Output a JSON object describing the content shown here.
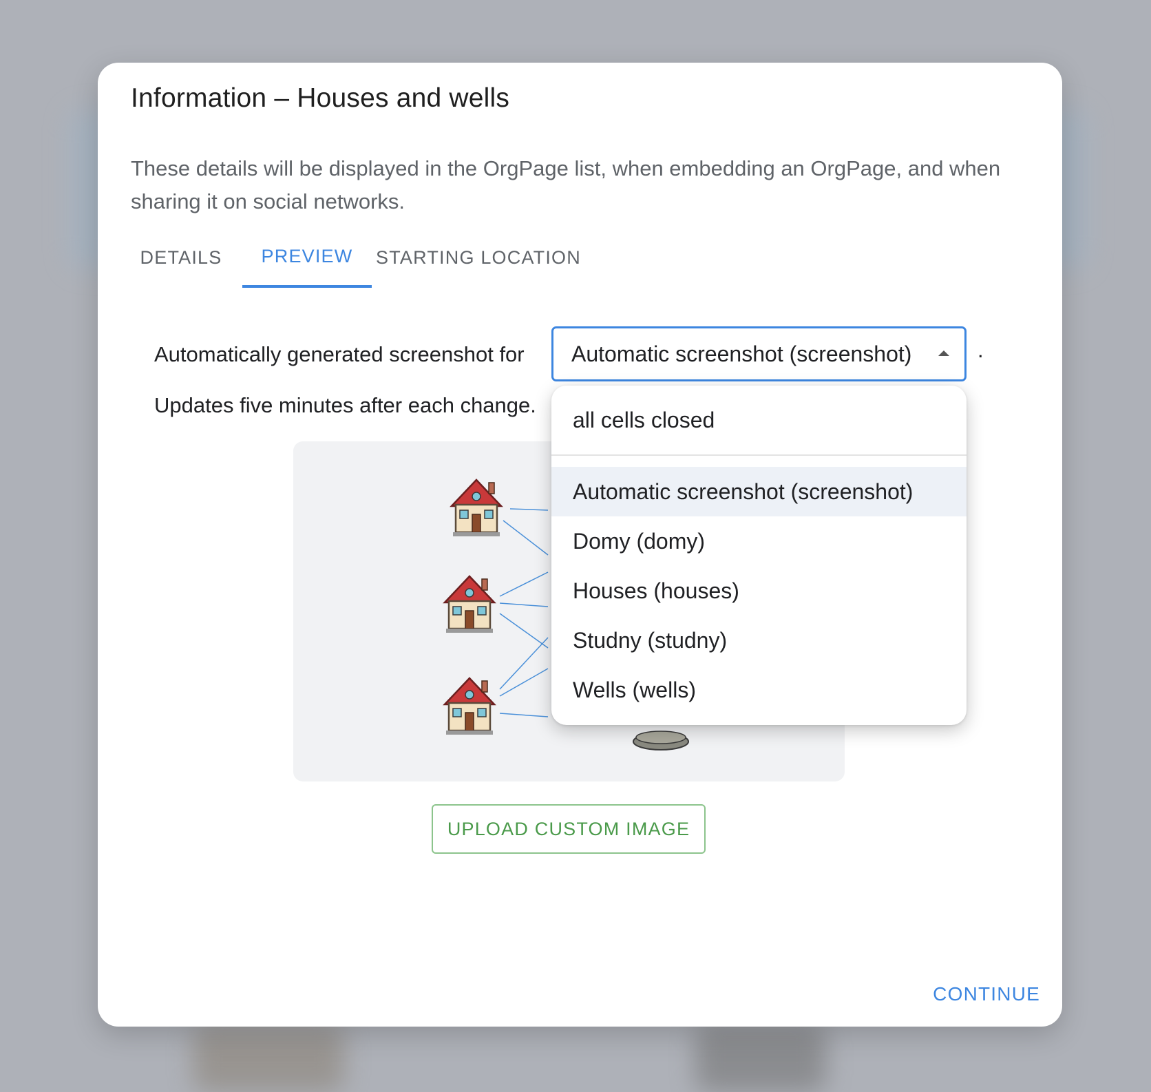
{
  "dialog": {
    "title": "Information – Houses and wells",
    "description": "These details will be displayed in the OrgPage list, when embedding an OrgPage, and when sharing it on social networks."
  },
  "tabs": [
    {
      "label": "DETAILS",
      "active": false
    },
    {
      "label": "PREVIEW",
      "active": true
    },
    {
      "label": "STARTING LOCATION",
      "active": false
    }
  ],
  "preview": {
    "auto_label": "Automatically generated screenshot for",
    "period": ".",
    "updates_label": "Updates five minutes after each change.",
    "select_value": "Automatic screenshot (screenshot)",
    "upload_label": "UPLOAD CUSTOM IMAGE"
  },
  "dropdown": {
    "header": "all cells closed",
    "options": [
      {
        "label": "Automatic screenshot (screenshot)",
        "selected": true
      },
      {
        "label": "Domy (domy)",
        "selected": false
      },
      {
        "label": "Houses (houses)",
        "selected": false
      },
      {
        "label": "Studny (studny)",
        "selected": false
      },
      {
        "label": "Wells (wells)",
        "selected": false
      }
    ]
  },
  "actions": {
    "continue_label": "CONTINUE"
  },
  "colors": {
    "accent": "#3d86e0",
    "upload_green": "#4a9a4a",
    "roof": "#c9393a",
    "connector": "#4a90d9"
  },
  "icons": [
    "house-icon",
    "well-icon",
    "caret-up-icon"
  ]
}
